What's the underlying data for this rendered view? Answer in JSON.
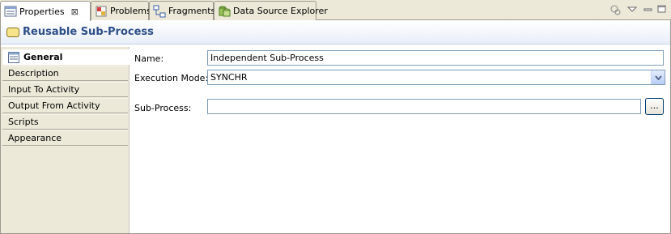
{
  "tabs": [
    {
      "label": "Properties",
      "icon": "properties-icon",
      "active": true,
      "close": "⊠"
    },
    {
      "label": "Problems",
      "icon": "problems-icon",
      "active": false
    },
    {
      "label": "Fragments",
      "icon": "fragments-icon",
      "active": false
    },
    {
      "label": "Data Source Explorer",
      "icon": "data-source-explorer-icon",
      "active": false
    }
  ],
  "toolbar": {
    "pin_icon": "pin-icon",
    "menu_icon": "view-menu-icon",
    "minimize_icon": "minimize-icon",
    "maximize_icon": "maximize-icon"
  },
  "section": {
    "title": "Reusable Sub-Process",
    "icon": "reusable-subprocess-icon"
  },
  "sections_list": [
    {
      "label": "General",
      "selected": true,
      "icon": "general-icon"
    },
    {
      "label": "Description"
    },
    {
      "label": "Input To Activity"
    },
    {
      "label": "Output From Activity"
    },
    {
      "label": "Scripts"
    },
    {
      "label": "Appearance"
    }
  ],
  "form": {
    "name_label": "Name:",
    "name_value": "Independent Sub-Process",
    "mode_label": "Execution Mode:",
    "mode_value": "SYNCHR",
    "subprocess_label": "Sub-Process:",
    "subprocess_value": "",
    "browse_label": "..."
  },
  "colors": {
    "title": "#2d4e86",
    "field_border": "#7f9db9",
    "tab_border": "#9e9a91"
  }
}
